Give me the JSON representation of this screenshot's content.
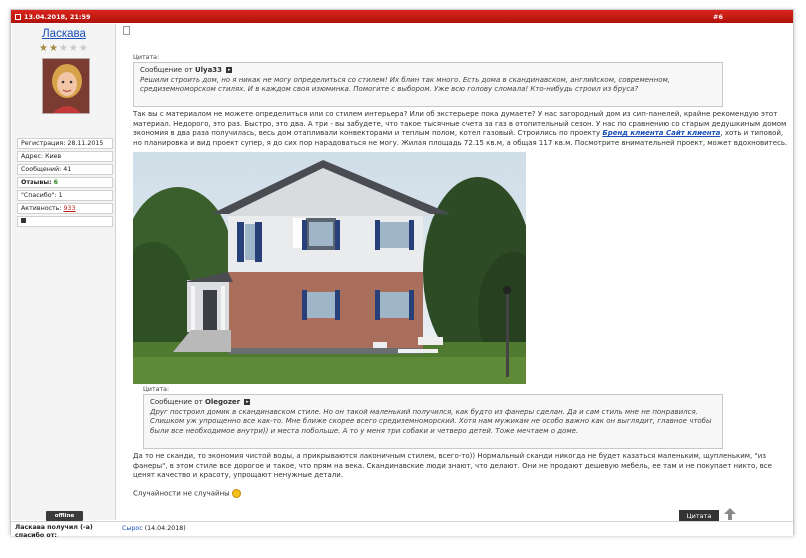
{
  "header": {
    "timestamp": "13.04.2018, 21:59",
    "post_number": "#6"
  },
  "user": {
    "name": "Ласкава",
    "rating_stars": 2,
    "rating_max": 5,
    "info": {
      "registration": "Регистрация: 28.11.2015",
      "address": "Адрес: Киев",
      "messages": "Сообщений: 41",
      "reviews_label": "Отзывы:",
      "reviews_value": "6",
      "thanks": "\"Спасибо\": 1",
      "activity_label": "Активность:",
      "activity_value": "933"
    },
    "status": "offline"
  },
  "quote1": {
    "label": "Цитата:",
    "author_prefix": "Сообщение от",
    "author": "Ulya33",
    "text": "Решили строить дом, но я никак не могу определиться со стилем! Их блин так много. Есть дома в скандинавском, английском, современном, средиземноморском стилях. И в каждом своя изюминка. Помогите с выбором. Уже всю голову сломала! Кто-нибудь строил из бруса?"
  },
  "reply1": {
    "part1": "Так вы с материалом не можете определиться или со стилем интерьера? Или об экстерьере пока думаете? У нас загородный дом из сип-панелей, крайне рекомендую этот материал. Недорого, это раз. Быстро, это два. А три - вы забудете, что такое тысячные счета за газ в отопительный сезон. У нас по сравнению со старым дедушкиным домом экономия в два раза получилась, весь дом отапливали конвекторами и теплым полом, котел газовый. Строились по проекту",
    "link": "Бренд клиента Сайт клиента",
    "part2": ", хоть и типовой, но планировка и вид проект супер, я до сих пор нарадоваться не могу. Жилая площадь 72.15 кв.м, а общая 117 кв.м. Посмотрите внимательней проект, может вдохновитесь."
  },
  "quote2": {
    "label": "Цитата:",
    "author_prefix": "Сообщение от",
    "author": "Olegozer",
    "text": "Друг построил домик в скандинавском стиле. Но он такой маленький получился, как будто из фанеры сделан. Да и сам стиль мне не понравился. Слишком уж упрощенно все как-то. Мне ближе скорее всего средиземноморский. Хотя нам мужикам не особо важно как он выглядит, главное чтобы были все необходимое внутри)) и места побольше. А то у меня три собаки и четверо детей. Тоже мечтаем о доме."
  },
  "reply2": "Да то не сканди, то экономия чистой воды, а прикрываются лаконичным стилем, всего-то)) Нормальный сканди никогда не будет казаться маленьким, щупленьким, \"из фанеры\", в этом стиле все дорогое и такое, что прям на века. Скандинавские люди знают, что делают. Они не продают дешевую мебель, ее там и не покупает никто, все ценят качество и красоту, упрощают ненужные детали.",
  "signature": "Случайности не случайны",
  "buttons": {
    "quote": "Цитата"
  },
  "footer": {
    "thanks_label": "Ласкава получил (-а) спасибо от:",
    "thanks_user": "Сырос",
    "thanks_date": "(14.04.2018)"
  },
  "colors": {
    "header_red": "#c41a12",
    "link_blue": "#1a4fb8",
    "star_gold": "#a38a44"
  }
}
